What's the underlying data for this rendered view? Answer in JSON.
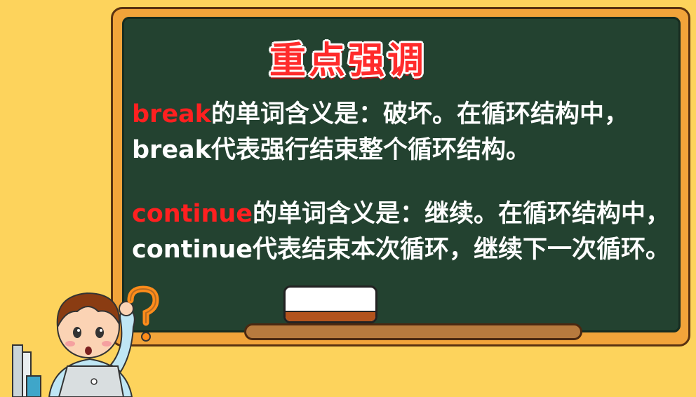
{
  "title": "重点强调",
  "paragraph1": {
    "keyword": "break",
    "text": "的单词含义是：破坏。在循环结构中，break代表强行结束整个循环结构。"
  },
  "paragraph2": {
    "keyword": "continue",
    "text": "的单词含义是：继续。在循环结构中，continue代表结束本次循环，继续下一次循环。"
  },
  "colors": {
    "background": "#fdd35c",
    "chalkboard": "#234230",
    "frame": "#f2a43a",
    "keyword": "#ff2020",
    "title": "#ff2b2b"
  }
}
